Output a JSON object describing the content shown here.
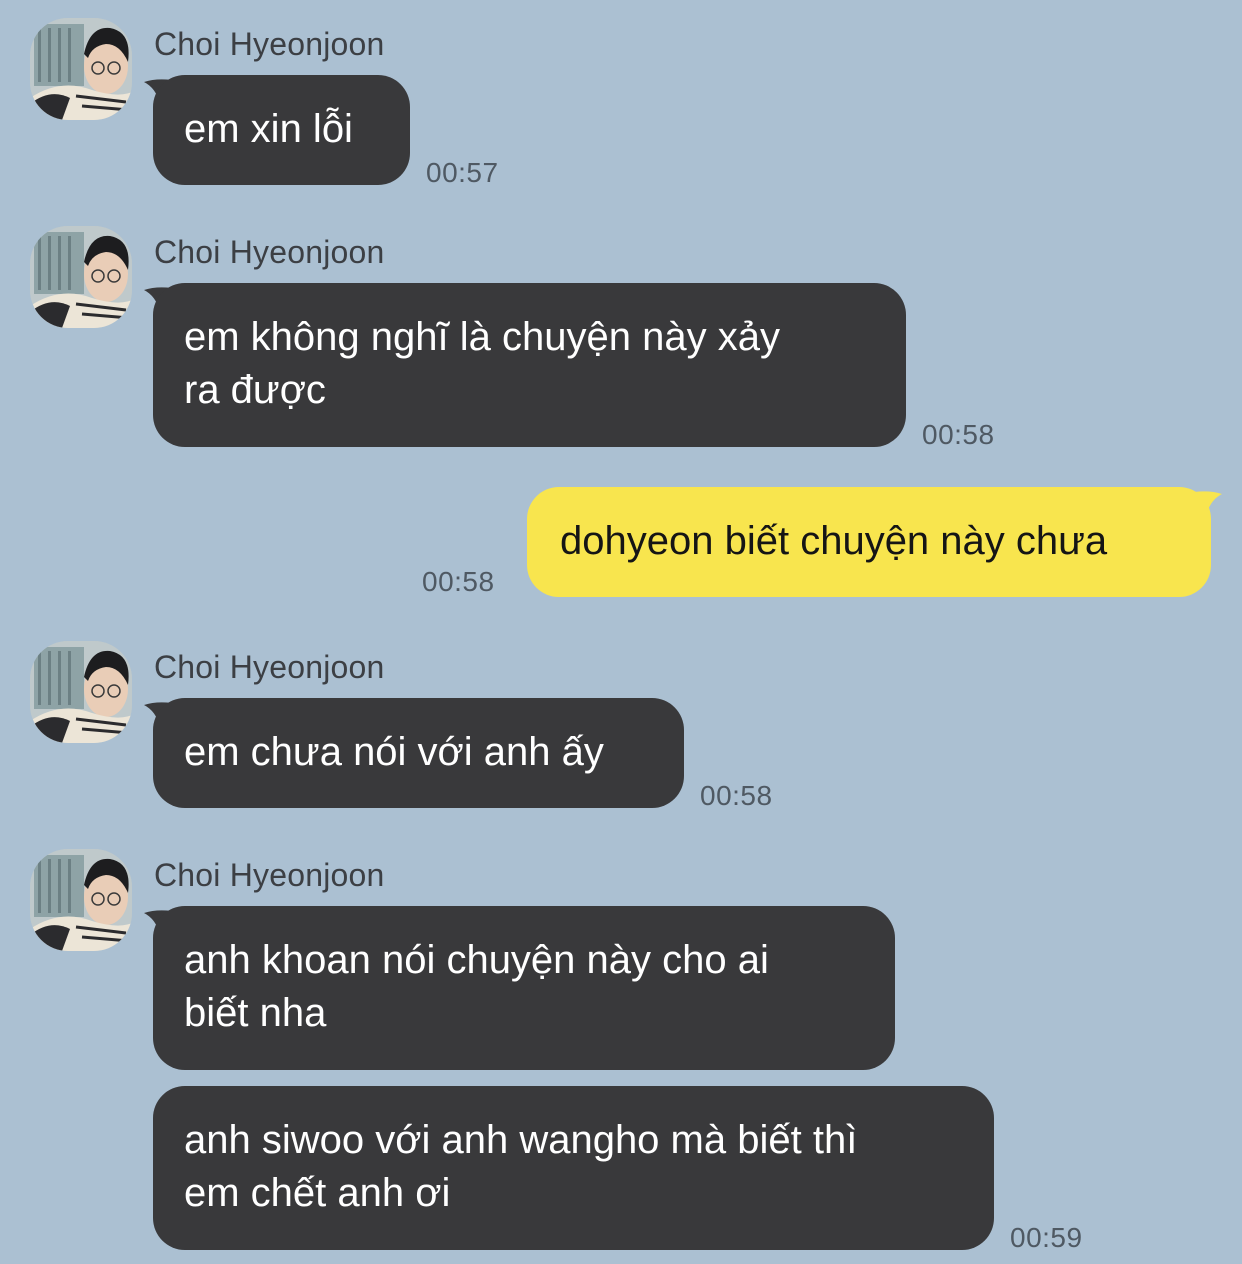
{
  "colors": {
    "background": "#abc0d2",
    "incoming_bubble": "#39393b",
    "outgoing_bubble": "#f8e54e"
  },
  "contact": {
    "name": "Choi Hyeonjoon",
    "avatar_icon": "profile-photo-avatar"
  },
  "messages": [
    {
      "sender": "Choi Hyeonjoon",
      "text": "em xin lỗi",
      "time": "00:57"
    },
    {
      "sender": "Choi Hyeonjoon",
      "text": "em không nghĩ là chuyện này xảy\nra được",
      "time": "00:58"
    },
    {
      "sender": "me",
      "text": "dohyeon biết chuyện này chưa",
      "time": "00:58"
    },
    {
      "sender": "Choi Hyeonjoon",
      "text": "em chưa nói với anh ấy",
      "time": "00:58"
    },
    {
      "sender": "Choi Hyeonjoon",
      "text": "anh khoan nói chuyện này cho ai\nbiết nha"
    },
    {
      "sender": "Choi Hyeonjoon",
      "text": "anh siwoo với anh wangho mà biết thì\nem chết anh ơi",
      "time": "00:59"
    }
  ]
}
